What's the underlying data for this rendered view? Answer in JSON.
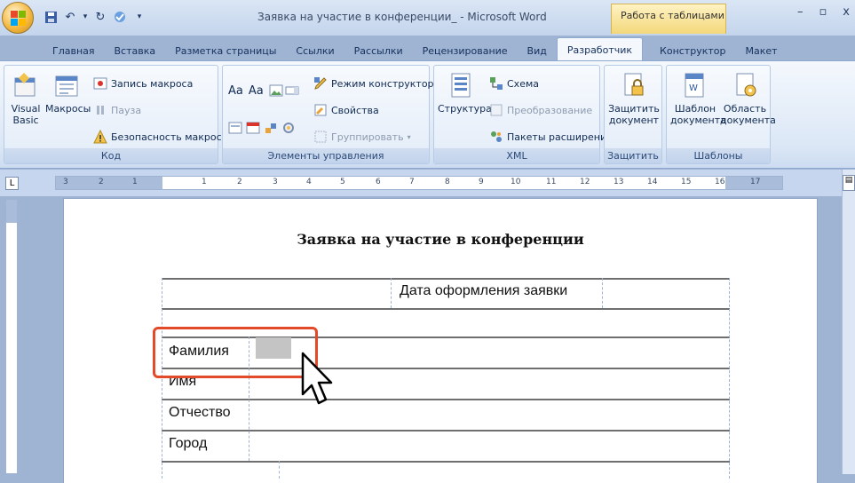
{
  "window": {
    "title": "Заявка на участие в конференции_ - Microsoft Word",
    "tools_tab": "Работа с таблицами",
    "controls": [
      "–",
      "▫",
      "x"
    ]
  },
  "tabs": [
    "Главная",
    "Вставка",
    "Разметка страницы",
    "Ссылки",
    "Рассылки",
    "Рецензирование",
    "Вид",
    "Разработчик",
    "Конструктор",
    "Макет"
  ],
  "active_tab": "Разработчик",
  "ribbon": {
    "code": {
      "label": "Код",
      "visual_basic": "Visual\nBasic",
      "macros": "Макросы",
      "record_macro": "Запись макроса",
      "pause": "Пауза",
      "macro_security": "Безопасность макросов"
    },
    "controls": {
      "label": "Элементы управления",
      "design_mode": "Режим конструктора",
      "properties": "Свойства",
      "group": "Группировать"
    },
    "xml": {
      "label": "XML",
      "structure": "Структура",
      "schema": "Схема",
      "transform": "Преобразование",
      "expansion_packs": "Пакеты расширения"
    },
    "protect": {
      "label": "Защитить",
      "protect_doc": "Защитить\nдокумент"
    },
    "templates": {
      "label": "Шаблоны",
      "doc_template": "Шаблон\nдокумента",
      "doc_panel": "Область\nдокумента"
    }
  },
  "ruler": {
    "numbers": [
      "3",
      "2",
      "1",
      "1",
      "2",
      "3",
      "4",
      "5",
      "6",
      "7",
      "8",
      "9",
      "10",
      "11",
      "12",
      "13",
      "14",
      "15",
      "16",
      "17"
    ]
  },
  "document": {
    "title": "Заявка на участие в конференции",
    "date_label": "Дата оформления заявки",
    "rows": [
      "Фамилия",
      "Имя",
      "Отчество",
      "Город"
    ]
  },
  "colors": {
    "highlight": "#e24a2a",
    "ribbon_bg": "#dbe7f6"
  }
}
